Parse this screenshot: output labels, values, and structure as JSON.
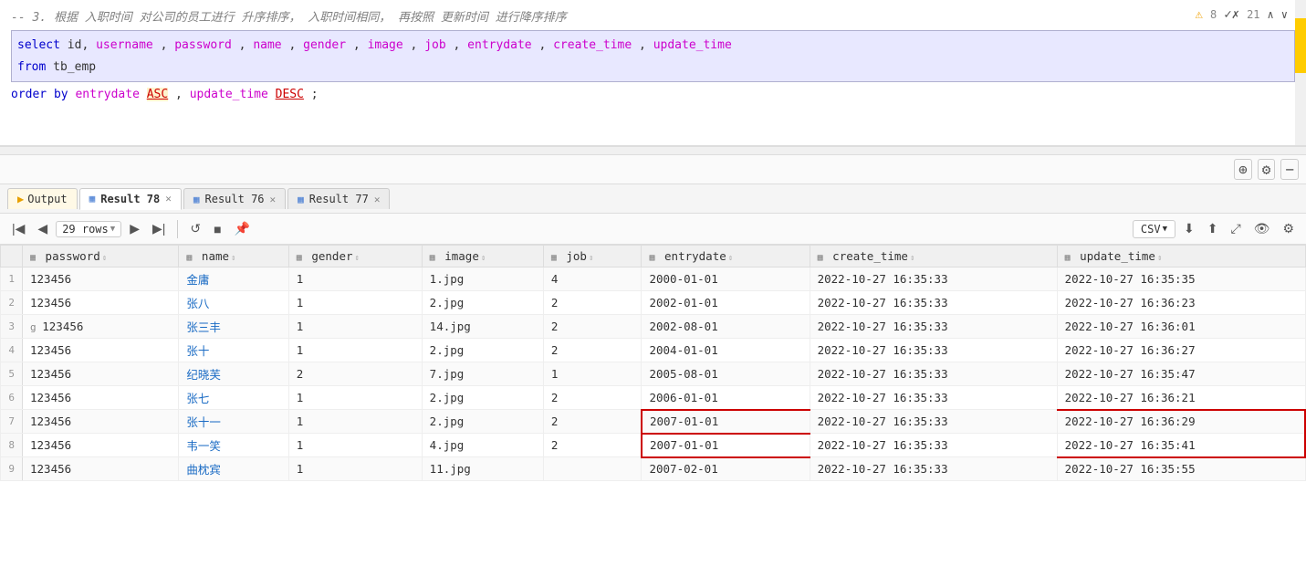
{
  "editor": {
    "comment_line": "-- 3. 根据 入职时间 对公司的员工进行 升序排序， 入职时间相同， 再按照 更新时间 进行降序排序",
    "sql_line1": "select id, username, password, name, gender, image, job, entrydate, create_time, update_time",
    "sql_line2": "from tb_emp",
    "sql_line3": "order by entrydate ASC , update_time DESC;"
  },
  "warnings": {
    "warning_count": "8",
    "check_count": "21"
  },
  "tabs": {
    "output": "Output",
    "result78": "Result 78",
    "result76": "Result 76",
    "result77": "Result 77"
  },
  "toolbar": {
    "rows_label": "29 rows",
    "csv_label": "CSV"
  },
  "table": {
    "columns": [
      "password",
      "name",
      "gender",
      "image",
      "job",
      "entrydate",
      "create_time",
      "update_time"
    ],
    "rows": [
      {
        "num": "1",
        "password": "123456",
        "name": "金庸",
        "gender": "1",
        "image": "1.jpg",
        "job": "4",
        "entrydate": "2000-01-01",
        "create_time": "2022-10-27 16:35:33",
        "update_time": "2022-10-27 16:35:35"
      },
      {
        "num": "2",
        "password": "123456",
        "name": "张八",
        "gender": "1",
        "image": "2.jpg",
        "job": "2",
        "entrydate": "2002-01-01",
        "create_time": "2022-10-27 16:35:33",
        "update_time": "2022-10-27 16:36:23"
      },
      {
        "num": "3",
        "password": "123456",
        "name": "张三丰",
        "gender": "1",
        "image": "14.jpg",
        "job": "2",
        "entrydate": "2002-08-01",
        "create_time": "2022-10-27 16:35:33",
        "update_time": "2022-10-27 16:36:01"
      },
      {
        "num": "4",
        "password": "123456",
        "name": "张十",
        "gender": "1",
        "image": "2.jpg",
        "job": "2",
        "entrydate": "2004-01-01",
        "create_time": "2022-10-27 16:35:33",
        "update_time": "2022-10-27 16:36:27"
      },
      {
        "num": "5",
        "password": "123456",
        "name": "纪晓芙",
        "gender": "2",
        "image": "7.jpg",
        "job": "1",
        "entrydate": "2005-08-01",
        "create_time": "2022-10-27 16:35:33",
        "update_time": "2022-10-27 16:35:47"
      },
      {
        "num": "6",
        "password": "123456",
        "name": "张七",
        "gender": "1",
        "image": "2.jpg",
        "job": "2",
        "entrydate": "2006-01-01",
        "create_time": "2022-10-27 16:35:33",
        "update_time": "2022-10-27 16:36:21"
      },
      {
        "num": "7",
        "password": "123456",
        "name": "张十一",
        "gender": "1",
        "image": "2.jpg",
        "job": "2",
        "entrydate": "2007-01-01",
        "create_time": "2022-10-27 16:35:33",
        "update_time": "2022-10-27 16:36:29"
      },
      {
        "num": "8",
        "password": "123456",
        "name": "韦一笑",
        "gender": "1",
        "image": "4.jpg",
        "job": "2",
        "entrydate": "2007-01-01",
        "create_time": "2022-10-27 16:35:33",
        "update_time": "2022-10-27 16:35:41"
      },
      {
        "num": "9",
        "password": "123456",
        "name": "曲枕宾",
        "gender": "1",
        "image": "11.jpg",
        "job": "",
        "entrydate": "2007-02-01",
        "create_time": "2022-10-27 16:35:33",
        "update_time": "2022-10-27 16:35:55"
      }
    ]
  }
}
